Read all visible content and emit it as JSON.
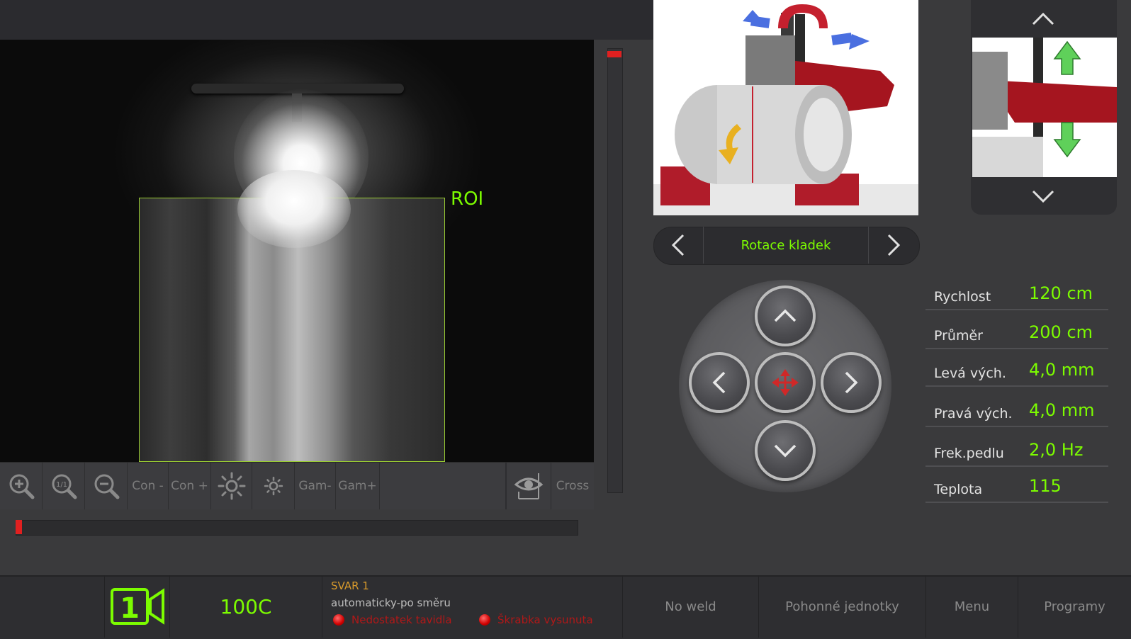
{
  "camera": {
    "roi_label": "ROI"
  },
  "toolbar": {
    "buttons": [
      {
        "name": "zoom-in-button",
        "label": ""
      },
      {
        "name": "zoom-reset-button",
        "label": ""
      },
      {
        "name": "zoom-out-button",
        "label": ""
      },
      {
        "name": "contrast-minus-button",
        "label": "Con -"
      },
      {
        "name": "contrast-plus-button",
        "label": "Con +"
      },
      {
        "name": "brightness-plus-button",
        "label": ""
      },
      {
        "name": "brightness-minus-button",
        "label": ""
      },
      {
        "name": "gamma-minus-button",
        "label": "Gam-"
      },
      {
        "name": "gamma-plus-button",
        "label": "Gam+"
      }
    ],
    "eye_icon": "eye-icon",
    "cross_label": "Cross"
  },
  "rotation": {
    "label": "Rotace kladek"
  },
  "params": [
    {
      "label": "Rychlost",
      "value": "120 cm"
    },
    {
      "label": "Průměr",
      "value": "200 cm"
    },
    {
      "label": "Levá vých.",
      "value": "4,0 mm"
    },
    {
      "label": "Pravá vých.",
      "value": "4,0 mm"
    },
    {
      "label": "Frek.pedlu",
      "value": "2,0 Hz"
    },
    {
      "label": "Teplota",
      "value": "115"
    }
  ],
  "status": {
    "camera_number": "1",
    "temperature": "100C",
    "weld_title": "SVAR 1",
    "weld_mode": "automaticky-po směru",
    "warnings": [
      "Nedostatek tavidla",
      "Škrabka vysunuta"
    ],
    "nav": [
      "No weld",
      "Pohonné jednotky",
      "Menu",
      "Programy"
    ]
  },
  "colors": {
    "accent_green": "#7cfc00",
    "warning_red": "#b01818",
    "title_orange": "#d89a2c"
  }
}
